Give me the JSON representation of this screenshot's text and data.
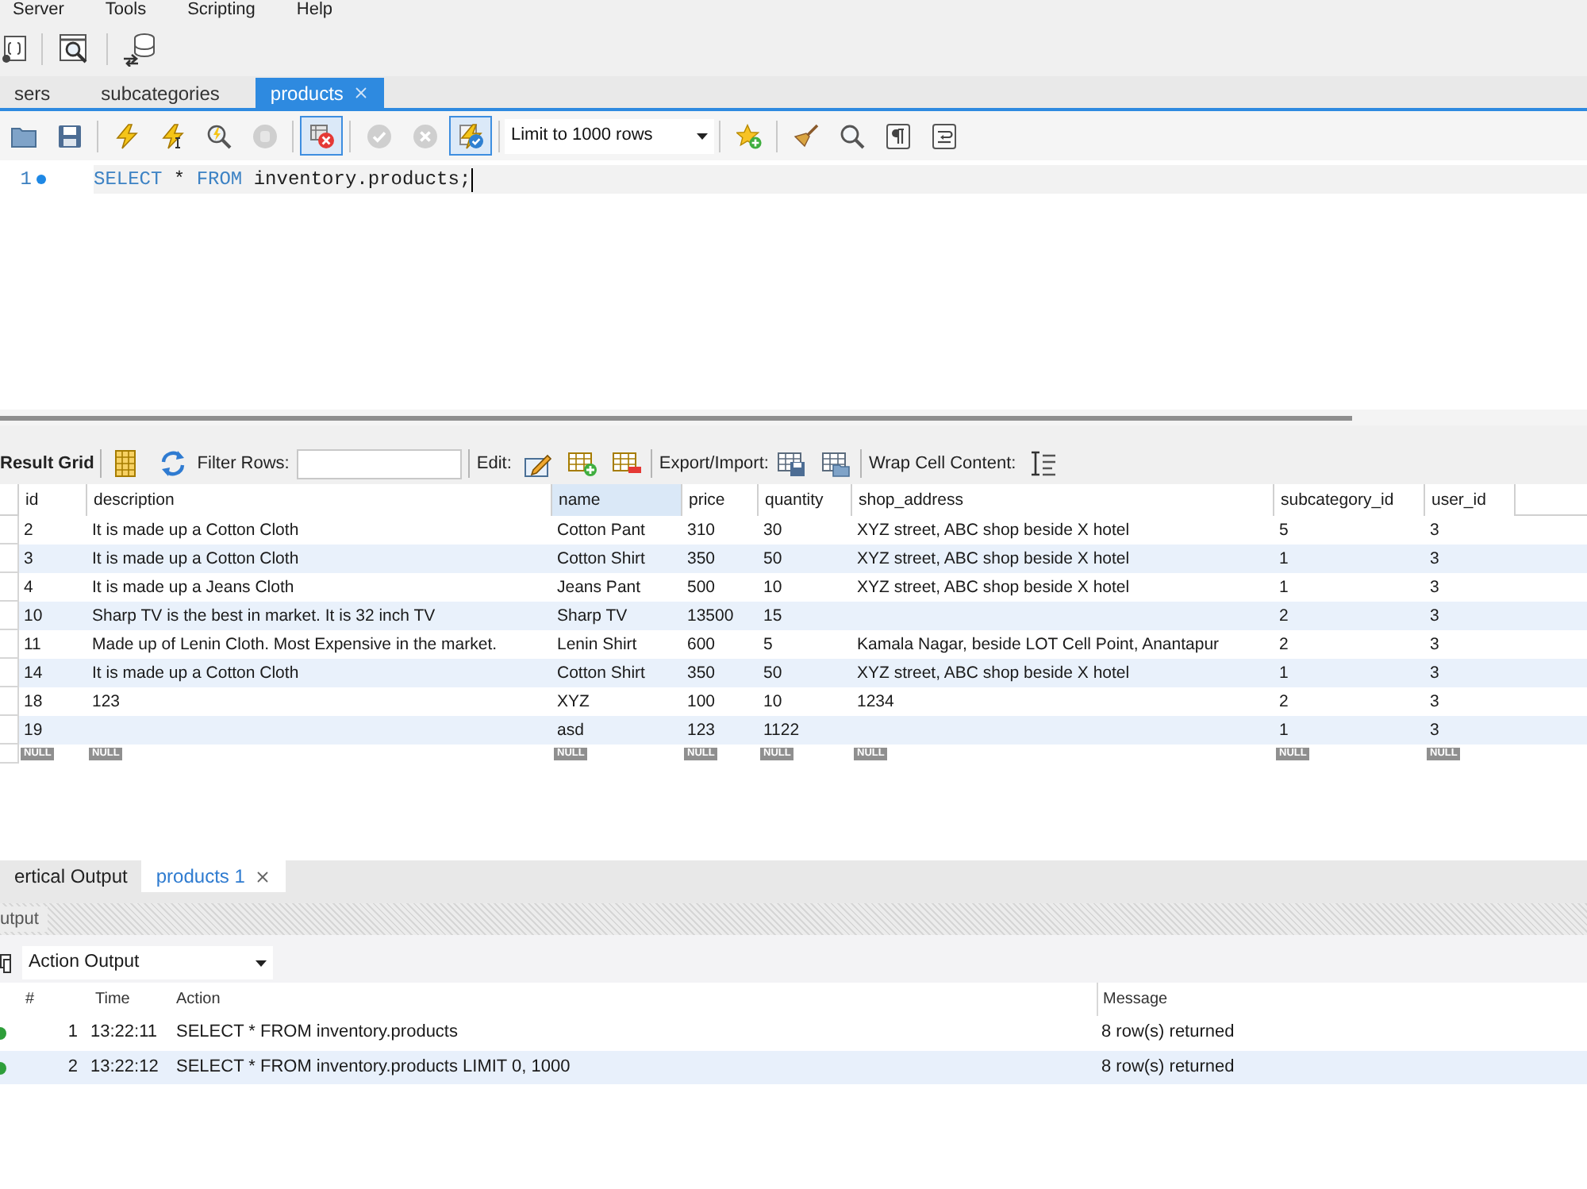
{
  "menu": [
    "Server",
    "Tools",
    "Scripting",
    "Help"
  ],
  "query_tabs": [
    {
      "label": "sers",
      "selected": false
    },
    {
      "label": "subcategories",
      "selected": false
    },
    {
      "label": "products",
      "selected": true
    }
  ],
  "editor_toolbar": [
    {
      "kind": "buttons",
      "buttons": [
        {
          "kind": "open",
          "disabled": false,
          "on": false
        },
        {
          "kind": "save",
          "disabled": false,
          "on": false
        }
      ]
    },
    {
      "kind": "buttons",
      "buttons": [
        {
          "kind": "execute",
          "disabled": false,
          "on": false
        },
        {
          "kind": "execute_line",
          "disabled": false,
          "on": false
        },
        {
          "kind": "explain",
          "disabled": false,
          "on": false
        },
        {
          "kind": "stop",
          "disabled": true,
          "on": false
        }
      ]
    },
    {
      "kind": "buttons",
      "buttons": [
        {
          "kind": "stop_on_error",
          "disabled": false,
          "on": true
        }
      ]
    },
    {
      "kind": "buttons",
      "buttons": [
        {
          "kind": "commit",
          "disabled": true,
          "on": false
        },
        {
          "kind": "rollback",
          "disabled": true,
          "on": false
        },
        {
          "kind": "autocommit",
          "disabled": false,
          "on": true
        }
      ]
    },
    {
      "kind": "dropdown",
      "value": "Limit to 1000 rows"
    },
    {
      "kind": "buttons",
      "buttons": [
        {
          "kind": "snippet",
          "disabled": false,
          "on": false
        }
      ]
    },
    {
      "kind": "buttons",
      "buttons": [
        {
          "kind": "beautify",
          "disabled": false,
          "on": false
        },
        {
          "kind": "find",
          "disabled": false,
          "on": false
        },
        {
          "kind": "invisibles",
          "disabled": false,
          "on": false
        },
        {
          "kind": "wrap",
          "disabled": false,
          "on": false
        }
      ]
    }
  ],
  "editor": {
    "lines": [
      {
        "number": "1",
        "tokens": [
          {
            "kind": "keyword",
            "text": "SELECT"
          },
          {
            "kind": "plain",
            "text": " * "
          },
          {
            "kind": "keyword",
            "text": "FROM"
          },
          {
            "kind": "plain",
            "text": " inventory.products;"
          }
        ]
      }
    ]
  },
  "result_toolbar": {
    "title": "Result Grid",
    "filter_label": "Filter Rows:",
    "edit_label": "Edit:",
    "export_label": "Export/Import:",
    "wrap_label": "Wrap Cell Content:"
  },
  "result_grid": {
    "columns": [
      {
        "label": "id",
        "selected": false
      },
      {
        "label": "description",
        "selected": false
      },
      {
        "label": "name",
        "selected": true
      },
      {
        "label": "price",
        "selected": false
      },
      {
        "label": "quantity",
        "selected": false
      },
      {
        "label": "shop_address",
        "selected": false
      },
      {
        "label": "subcategory_id",
        "selected": false
      },
      {
        "label": "user_id",
        "selected": false
      }
    ],
    "rows": [
      [
        "2",
        "It is made up a Cotton Cloth",
        "Cotton Pant",
        "310",
        "30",
        "XYZ street, ABC shop beside X hotel",
        "5",
        "3"
      ],
      [
        "3",
        "It is made up a Cotton Cloth",
        "Cotton Shirt",
        "350",
        "50",
        "XYZ street, ABC shop beside X hotel",
        "1",
        "3"
      ],
      [
        "4",
        "It is made up a Jeans Cloth",
        "Jeans Pant",
        "500",
        "10",
        "XYZ street, ABC shop beside X hotel",
        "1",
        "3"
      ],
      [
        "10",
        "Sharp TV is the best in market. It is 32 inch TV",
        "Sharp TV",
        "13500",
        "15",
        null,
        "2",
        "3"
      ],
      [
        "11",
        "Made up of Lenin Cloth. Most Expensive in the market.",
        "Lenin Shirt",
        "600",
        "5",
        "Kamala Nagar, beside LOT Cell Point, Anantapur",
        "2",
        "3"
      ],
      [
        "14",
        "It is made up a Cotton Cloth",
        "Cotton Shirt",
        "350",
        "50",
        "XYZ street, ABC shop beside X hotel",
        "1",
        "3"
      ],
      [
        "18",
        "123",
        "XYZ",
        "100",
        "10",
        "1234",
        "2",
        "3"
      ],
      [
        "19",
        null,
        "asd",
        "123",
        "1122",
        null,
        "1",
        "3"
      ]
    ],
    "new_row": [
      "NULL",
      "NULL",
      "NULL",
      "NULL",
      "NULL",
      "NULL",
      "NULL",
      "NULL"
    ]
  },
  "output_tabs": [
    {
      "label": "ertical Output",
      "selected": false
    },
    {
      "label": "products 1",
      "selected": true
    }
  ],
  "output_panel": {
    "title": "utput",
    "selector": "Action Output",
    "columns": [
      "#",
      "Time",
      "Action",
      "Message"
    ],
    "rows": [
      {
        "color": "#2e9e3a",
        "number": "1",
        "time": "13:22:11",
        "action": "SELECT * FROM inventory.products",
        "message": "8 row(s) returned",
        "selected": false
      },
      {
        "color": "#2e9e3a",
        "number": "2",
        "time": "13:22:12",
        "action": "SELECT * FROM inventory.products LIMIT 0, 1000",
        "message": "8 row(s) returned",
        "selected": true
      }
    ]
  }
}
